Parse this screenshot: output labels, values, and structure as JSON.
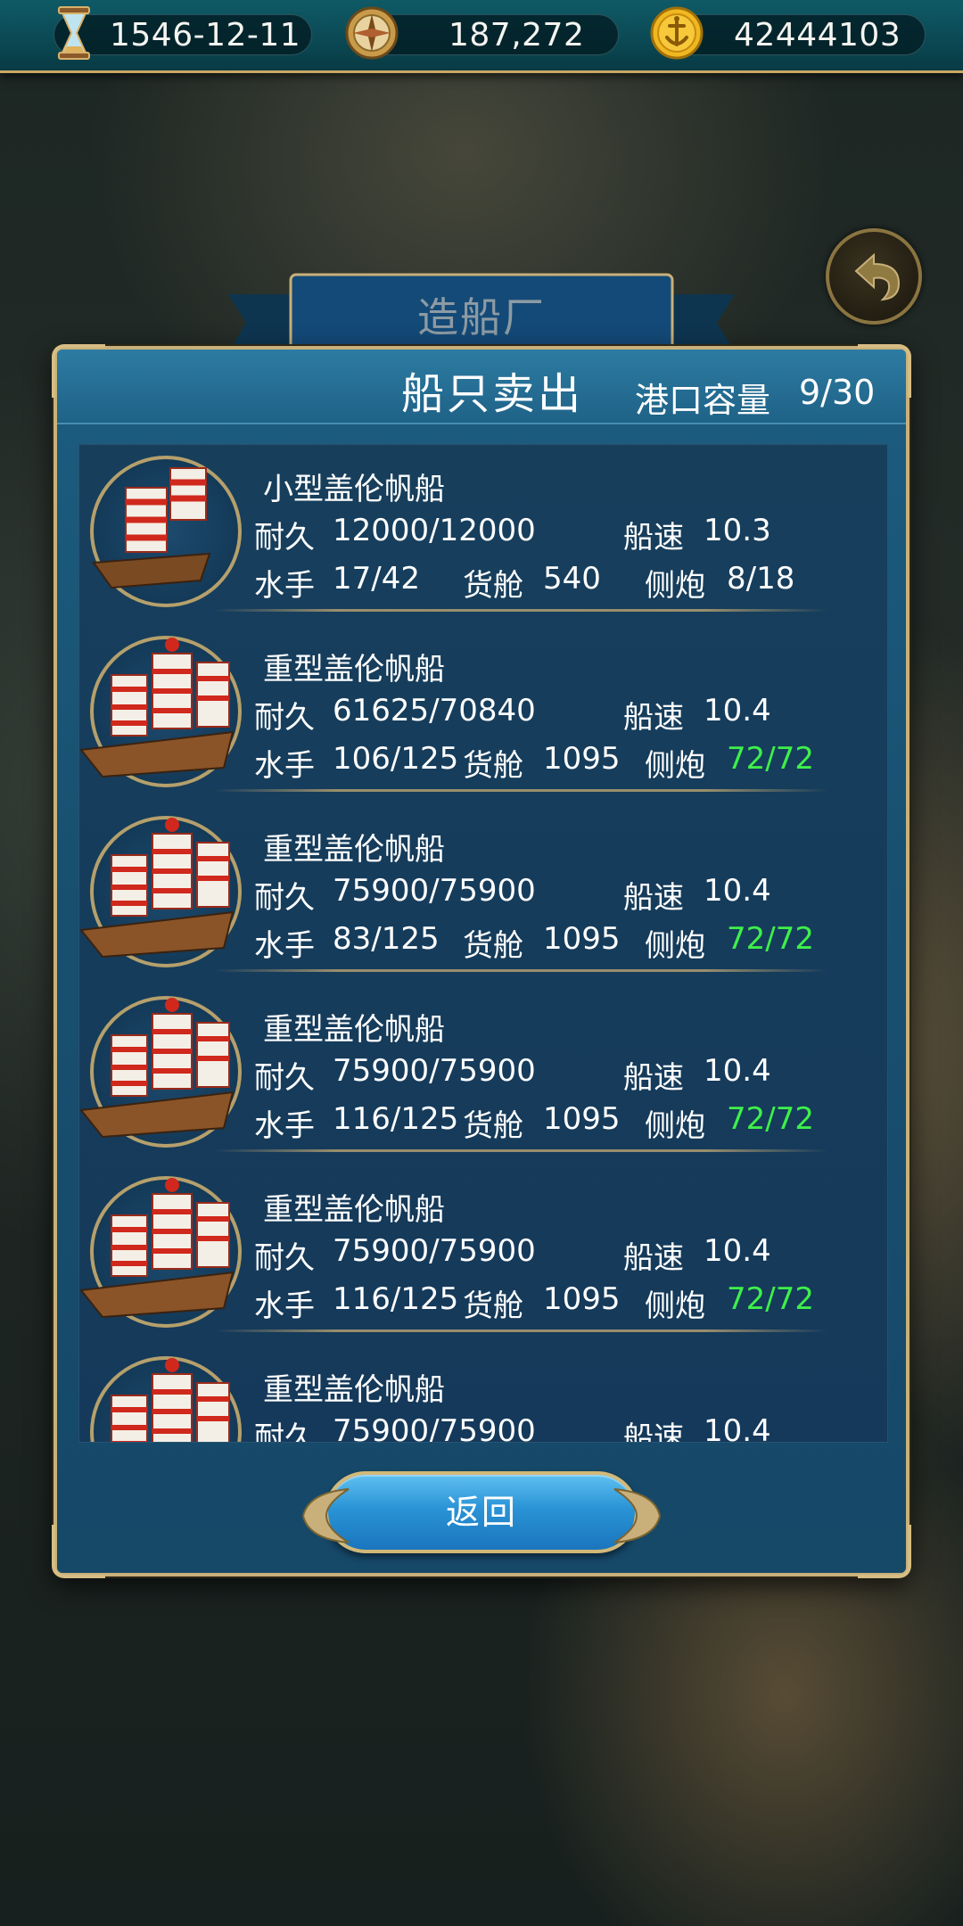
{
  "topbar": {
    "date": "1546-12-11",
    "reputation": "187,272",
    "gold": "42444103",
    "icons": [
      "hourglass-icon",
      "compass-icon",
      "gold-coin-anchor-icon"
    ]
  },
  "background": {
    "banner_title": "造船厂",
    "back_icon": "back-arrow-icon"
  },
  "panel": {
    "title": "船只卖出",
    "capacity_label": "港口容量",
    "capacity_value": "9/30"
  },
  "labels": {
    "durability": "耐久",
    "speed": "船速",
    "crew": "水手",
    "cargo": "货舱",
    "cannons": "侧炮"
  },
  "ships": [
    {
      "name": "小型盖伦帆船",
      "durability": "12000/12000",
      "speed": "10.3",
      "crew": "17/42",
      "cargo": "540",
      "cannons": "8/18",
      "cannons_full": false
    },
    {
      "name": "重型盖伦帆船",
      "durability": "61625/70840",
      "speed": "10.4",
      "crew": "106/125",
      "cargo": "1095",
      "cannons": "72/72",
      "cannons_full": true
    },
    {
      "name": "重型盖伦帆船",
      "durability": "75900/75900",
      "speed": "10.4",
      "crew": "83/125",
      "cargo": "1095",
      "cannons": "72/72",
      "cannons_full": true
    },
    {
      "name": "重型盖伦帆船",
      "durability": "75900/75900",
      "speed": "10.4",
      "crew": "116/125",
      "cargo": "1095",
      "cannons": "72/72",
      "cannons_full": true
    },
    {
      "name": "重型盖伦帆船",
      "durability": "75900/75900",
      "speed": "10.4",
      "crew": "116/125",
      "cargo": "1095",
      "cannons": "72/72",
      "cannons_full": true
    },
    {
      "name": "重型盖伦帆船",
      "durability": "75900/75900",
      "speed": "10.4",
      "crew": "",
      "cargo": "",
      "cannons": "",
      "cannons_full": true
    }
  ],
  "buttons": {
    "return_label": "返回"
  },
  "colors": {
    "accent_gold": "#c9b07a",
    "full_green": "#3ef04a",
    "panel_blue": "#1c5d80"
  }
}
